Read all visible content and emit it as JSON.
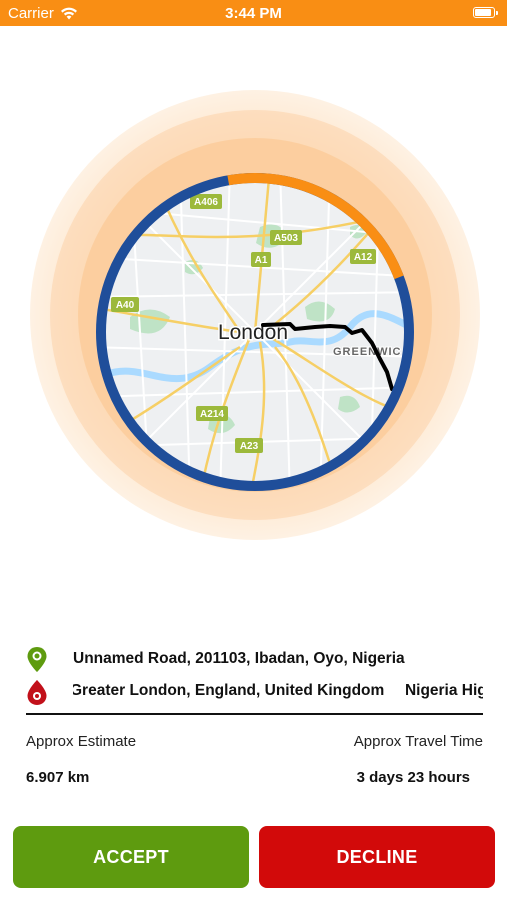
{
  "status_bar": {
    "carrier": "Carrier",
    "time": "3:44 PM"
  },
  "map": {
    "city_label": "London",
    "area_label": "GREENWIC",
    "road_labels": [
      "A406",
      "A503",
      "A1",
      "A12",
      "A40",
      "A214",
      "A23"
    ],
    "progress_fraction": 0.22,
    "colors": {
      "ring_blue": "#1F4E9A",
      "progress_orange": "#F98E14",
      "route": "#000000"
    }
  },
  "trip": {
    "pickup_address": "Unnamed Road, 201103, Ibadan, Oyo, Nigeria",
    "dropoff_address": "Greater London, England, United Kingdom",
    "dropoff_address_extra": "Nigeria High C",
    "estimate_label": "Approx Estimate",
    "estimate_value": "6.907 km",
    "travel_time_label": "Approx Travel Time",
    "travel_time_value": "3 days 23 hours"
  },
  "actions": {
    "accept_label": "ACCEPT",
    "decline_label": "DECLINE",
    "accept_color": "#5E9B0F",
    "decline_color": "#D20A0A"
  },
  "icons": {
    "pickup": "pickup-pin-icon",
    "dropoff": "dropoff-pin-icon",
    "wifi": "wifi-icon",
    "battery": "battery-icon"
  }
}
